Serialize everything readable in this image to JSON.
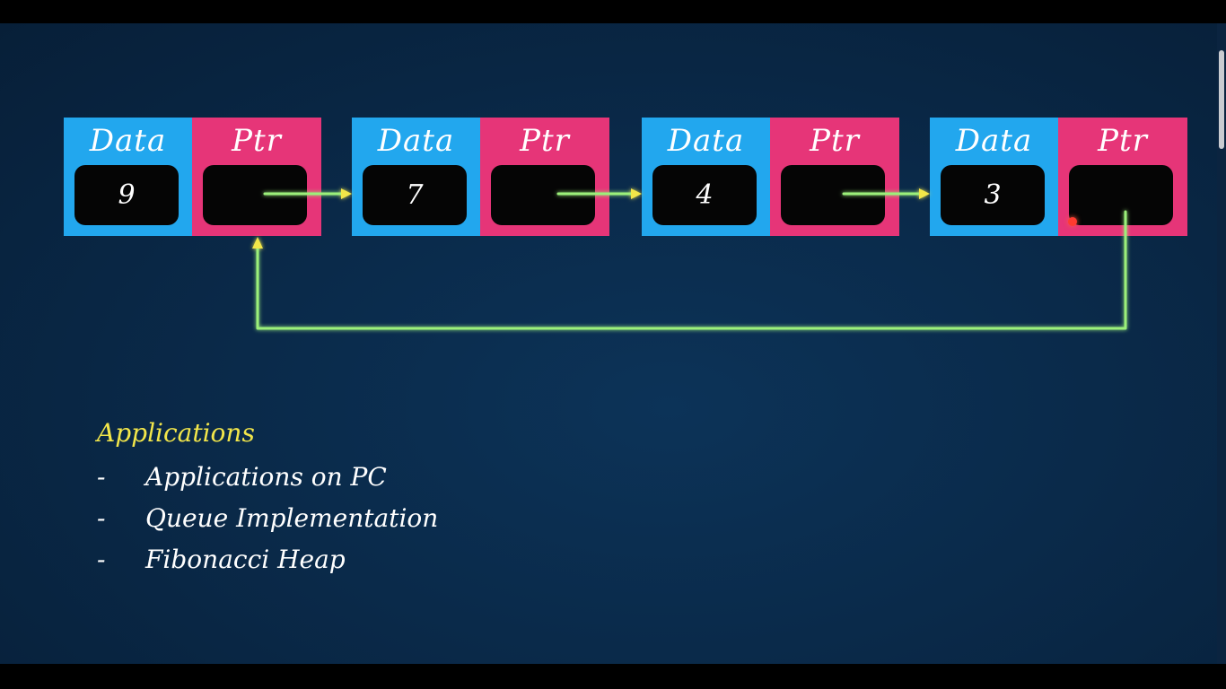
{
  "nodes": [
    {
      "data_label": "Data",
      "ptr_label": "Ptr",
      "value": "9"
    },
    {
      "data_label": "Data",
      "ptr_label": "Ptr",
      "value": "7"
    },
    {
      "data_label": "Data",
      "ptr_label": "Ptr",
      "value": "4"
    },
    {
      "data_label": "Data",
      "ptr_label": "Ptr",
      "value": "3"
    }
  ],
  "applications": {
    "title": "Applications",
    "items": [
      {
        "dash": "-",
        "text": "Applications on PC"
      },
      {
        "dash": "-",
        "text": "Queue Implementation"
      },
      {
        "dash": "-",
        "text": "Fibonacci Heap"
      }
    ]
  },
  "colors": {
    "data_cell": "#22a7ee",
    "ptr_cell": "#e63578",
    "arrow": "#9cf07a",
    "arrow_head": "#f2e64a",
    "title": "#f2e64a"
  }
}
